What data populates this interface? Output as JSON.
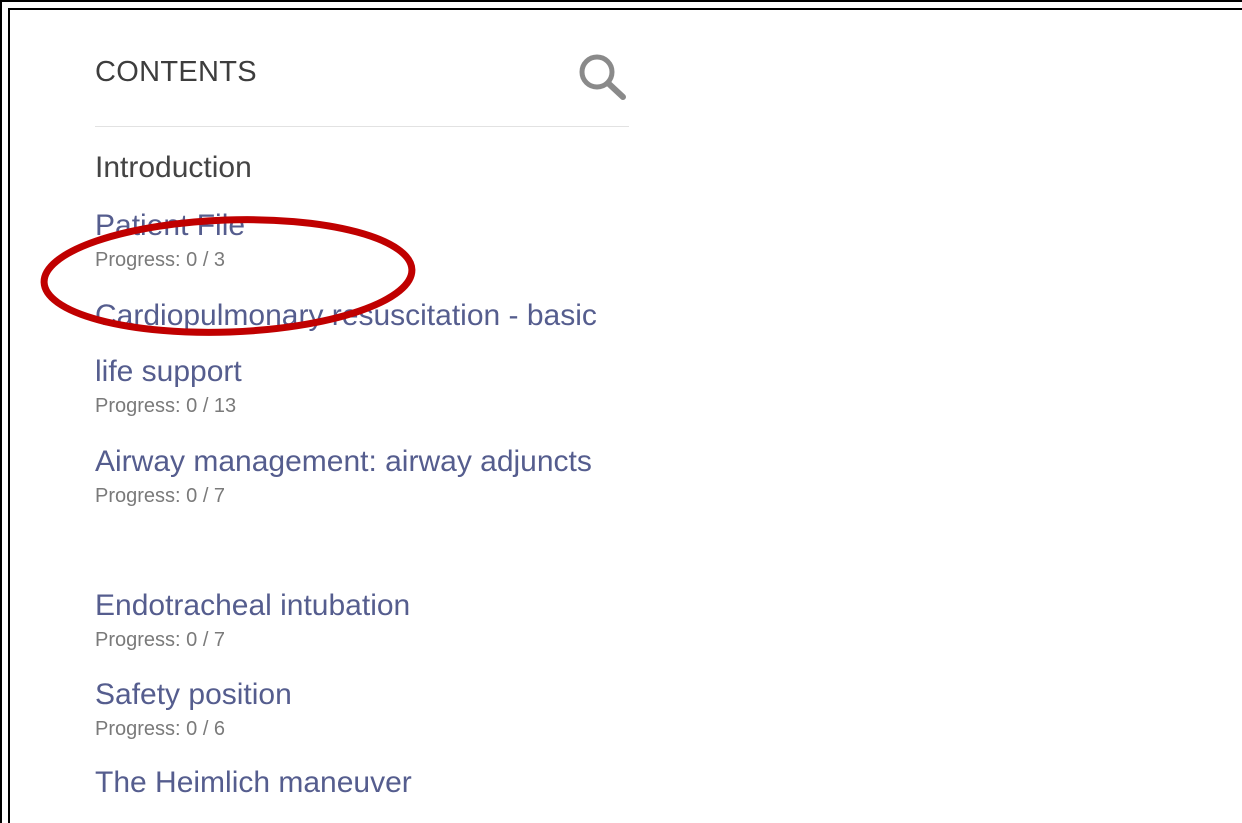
{
  "toc": {
    "title": "CONTENTS",
    "search_icon": "search-icon",
    "intro": "Introduction",
    "items": [
      {
        "title": "Patient File",
        "progress": "Progress: 0 / 3"
      },
      {
        "title": "Cardiopulmonary resuscitation - basic life support",
        "progress": "Progress: 0 / 13"
      },
      {
        "title": "Airway management: airway adjuncts",
        "progress": "Progress: 0 / 7"
      },
      {
        "title": "Endotracheal intubation",
        "progress": "Progress: 0 / 7"
      },
      {
        "title": "Safety position",
        "progress": "Progress: 0 / 6"
      },
      {
        "title": "The Heimlich maneuver",
        "progress": ""
      }
    ]
  },
  "colors": {
    "link": "#555d8e",
    "annotation": "#c00000"
  }
}
